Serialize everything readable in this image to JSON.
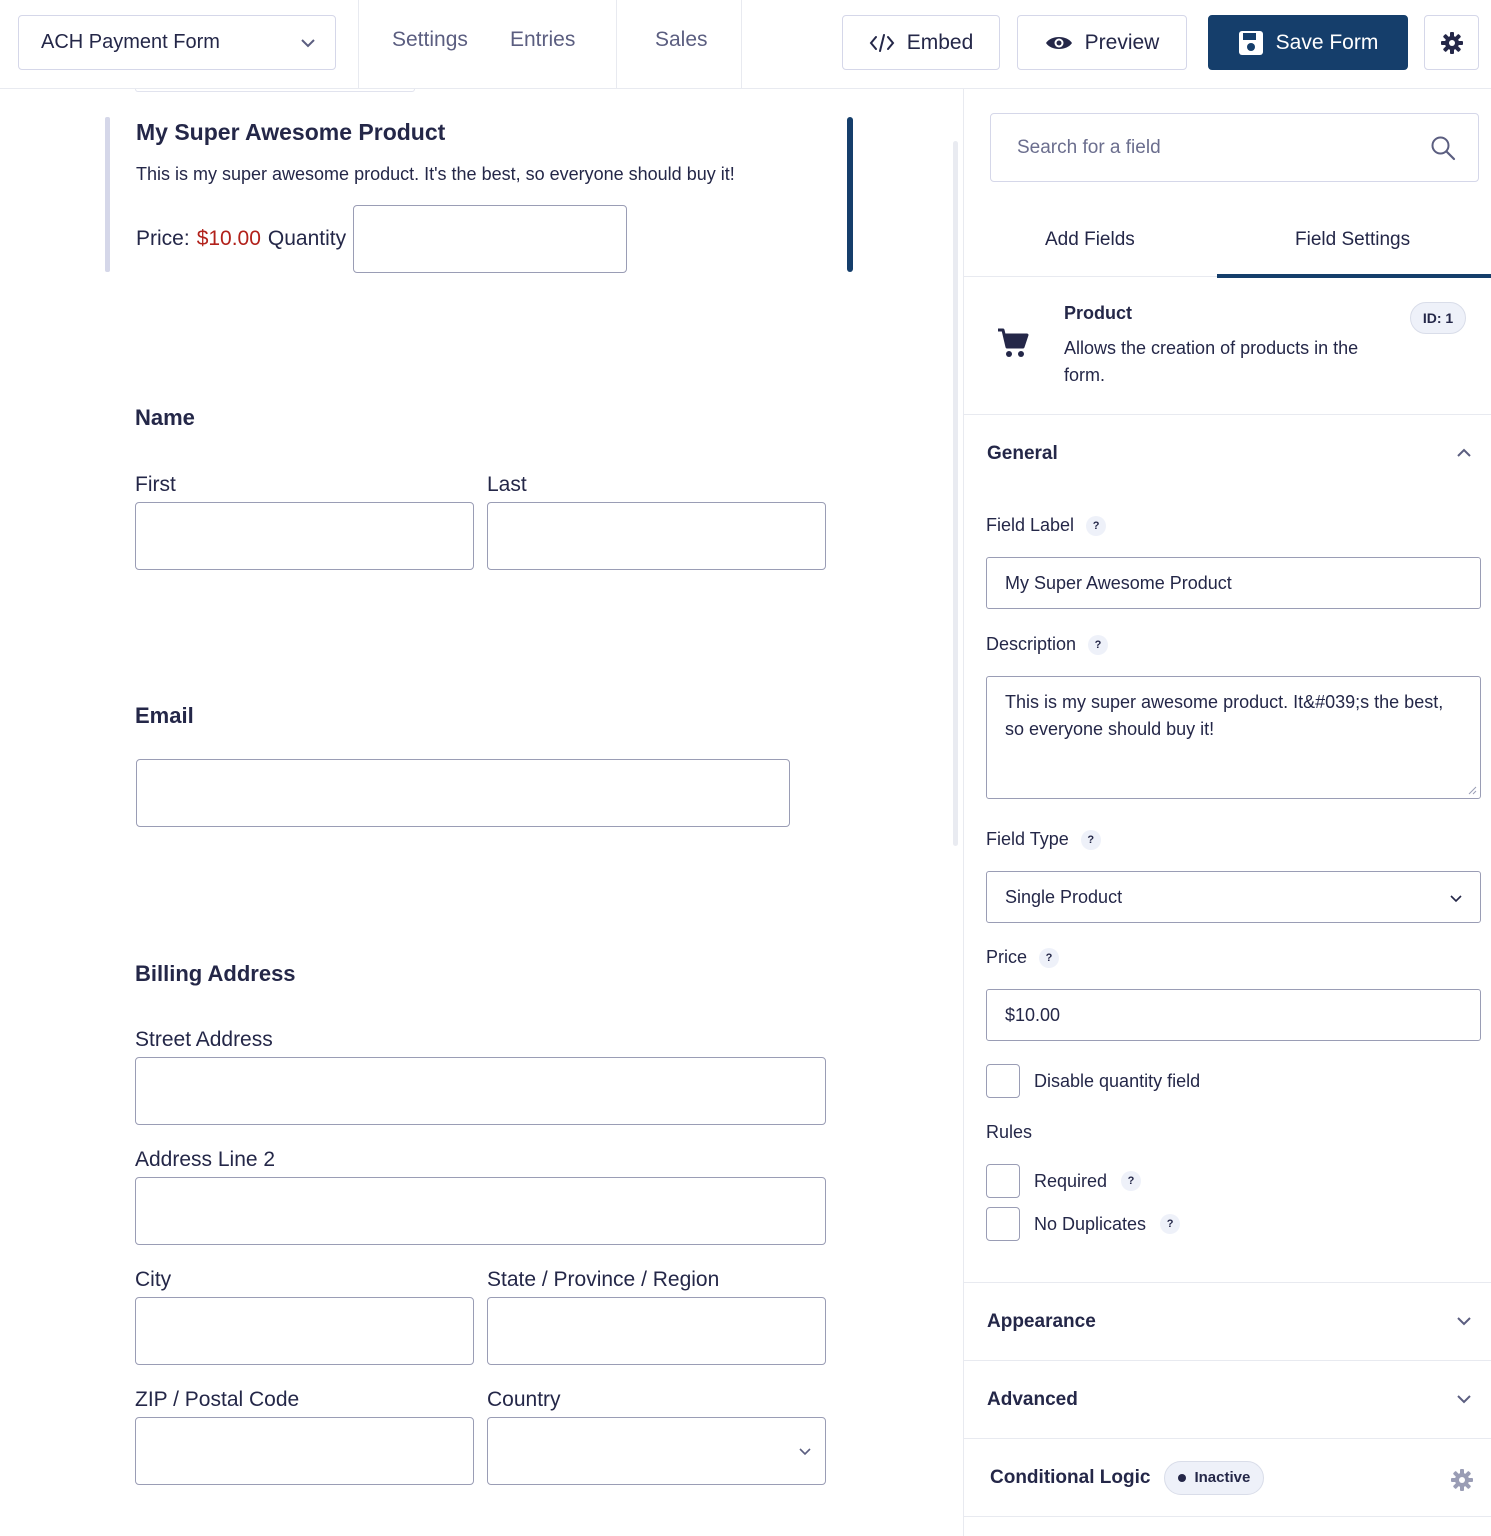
{
  "topbar": {
    "form_name": "ACH Payment Form",
    "nav": [
      "Settings",
      "Entries",
      "Sales"
    ],
    "embed_label": "Embed",
    "preview_label": "Preview",
    "save_label": "Save Form"
  },
  "canvas": {
    "product": {
      "title": "My Super Awesome Product",
      "description": "This is my super awesome product. It's the best, so everyone should buy it!",
      "price_label": "Price:",
      "price_value": "$10.00",
      "quantity_label": "Quantity"
    },
    "name": {
      "title": "Name",
      "first": "First",
      "last": "Last"
    },
    "email": {
      "title": "Email"
    },
    "address": {
      "title": "Billing Address",
      "street": "Street Address",
      "line2": "Address Line 2",
      "city": "City",
      "state": "State / Province / Region",
      "zip": "ZIP / Postal Code",
      "country": "Country"
    }
  },
  "sidebar": {
    "search_placeholder": "Search for a field",
    "tabs": [
      "Add Fields",
      "Field Settings"
    ],
    "active_tab": "Field Settings",
    "field": {
      "title": "Product",
      "description": "Allows the creation of products in the form.",
      "id_badge": "ID: 1",
      "icon": "cart-icon"
    },
    "general": {
      "title": "General",
      "field_label_label": "Field Label",
      "field_label_value": "My Super Awesome Product",
      "description_label": "Description",
      "description_value": "This is my super awesome product. It&#039;s the best, so everyone should buy it!",
      "field_type_label": "Field Type",
      "field_type_value": "Single Product",
      "price_label": "Price",
      "price_value": "$10.00",
      "disable_quantity_label": "Disable quantity field",
      "rules_label": "Rules",
      "required_label": "Required",
      "no_duplicates_label": "No Duplicates"
    },
    "appearance_title": "Appearance",
    "advanced_title": "Advanced",
    "conditional_logic": {
      "title": "Conditional Logic",
      "status": "Inactive"
    }
  },
  "colors": {
    "primary": "#153e6b",
    "price_red": "#b2211b",
    "text": "#242748",
    "muted": "#5b5e80"
  }
}
